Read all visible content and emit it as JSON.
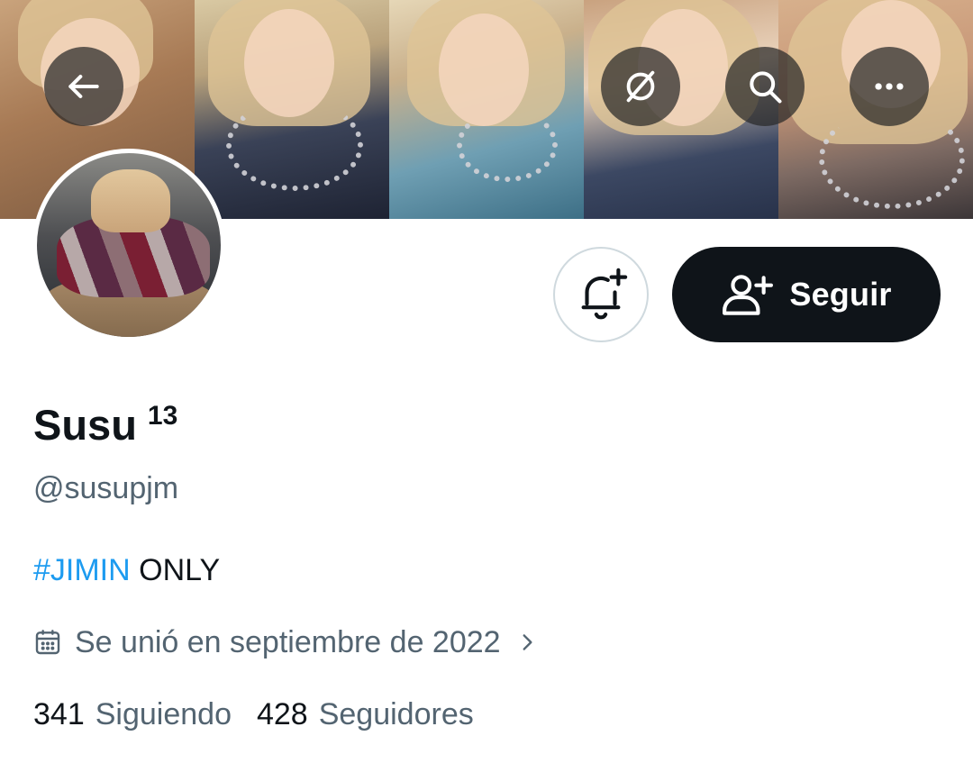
{
  "header": {
    "back_icon": "arrow-left-icon",
    "unlink_icon": "link-off-icon",
    "search_icon": "search-icon",
    "more_icon": "more-horizontal-icon"
  },
  "profile": {
    "name": "Susu",
    "name_superscript": "13",
    "handle": "@susupjm",
    "bio_hashtag": "#JIMIN",
    "bio_rest": " ONLY",
    "joined": "Se unió en septiembre de 2022",
    "following_count": "341",
    "following_label": "Siguiendo",
    "followers_count": "428",
    "followers_label": "Seguidores"
  },
  "actions": {
    "notify_icon": "bell-plus-icon",
    "follow_label": "Seguir"
  },
  "colors": {
    "accent": "#1d9bf0",
    "text": "#0f1419",
    "secondary": "#536471",
    "button_bg": "#0f1419"
  }
}
